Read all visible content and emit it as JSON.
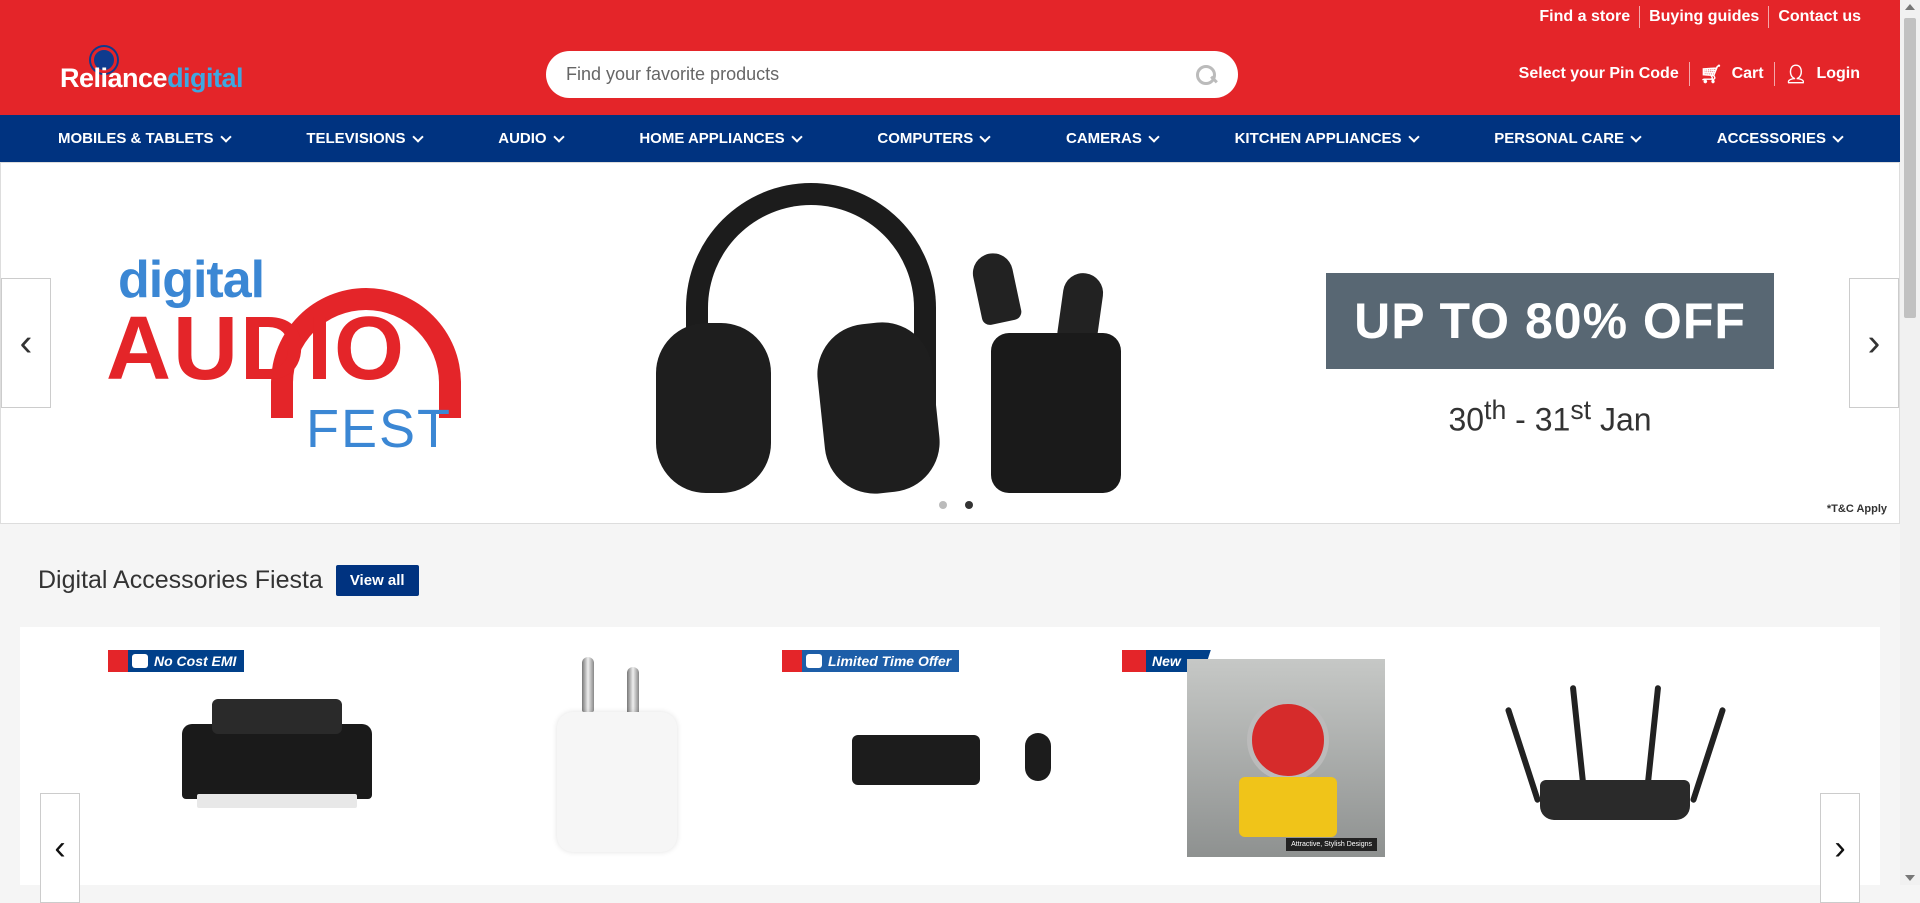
{
  "header": {
    "logo": {
      "part1": "Reliance",
      "part2": "digital"
    },
    "top_links": [
      "Find a store",
      "Buying guides",
      "Contact us"
    ],
    "search": {
      "placeholder": "Find your favorite products"
    },
    "pincode": "Select your Pin Code",
    "cart": "Cart",
    "login": "Login",
    "colors": {
      "header_bg": "#e42529",
      "nav_bg": "#003380"
    }
  },
  "nav": {
    "items": [
      "MOBILES & TABLETS",
      "TELEVISIONS",
      "AUDIO",
      "HOME APPLIANCES",
      "COMPUTERS",
      "CAMERAS",
      "KITCHEN APPLIANCES",
      "PERSONAL CARE",
      "ACCESSORIES"
    ]
  },
  "banner": {
    "fest_line1": "digital",
    "fest_line2": "AUDIO",
    "fest_line3": "FEST",
    "offer": "UP TO 80% OFF",
    "dates": {
      "d1": "30",
      "s1": "th",
      "sep": " - ",
      "d2": "31",
      "s2": "st",
      "month": " Jan"
    },
    "tc": "*T&C Apply",
    "slides": 2,
    "active_slide": 2
  },
  "section": {
    "title": "Digital Accessories Fiesta",
    "view_all": "View all",
    "badges": {
      "emi": "No Cost EMI",
      "lto": "Limited Time Offer",
      "new": "New"
    },
    "stand_caption": "Attractive, Stylish Designs"
  }
}
